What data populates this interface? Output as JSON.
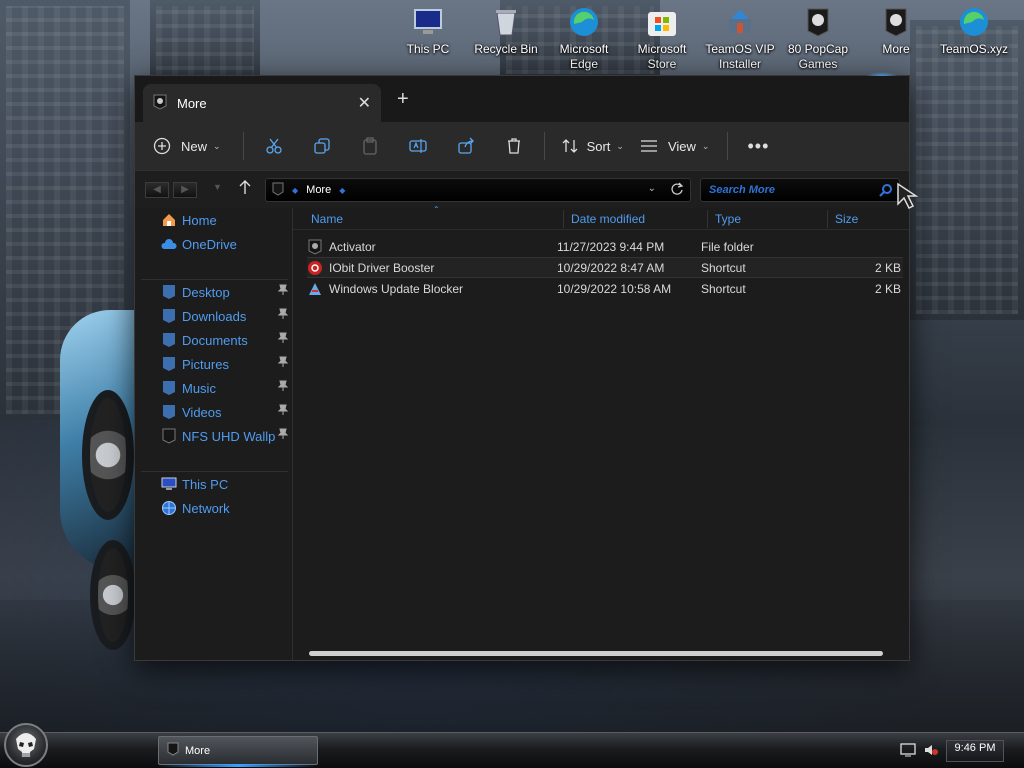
{
  "desktop": {
    "icons": [
      {
        "label": "This PC",
        "icon": "monitor-icon"
      },
      {
        "label": "Recycle Bin",
        "icon": "recycle-bin-icon"
      },
      {
        "label": "Microsoft Edge",
        "icon": "edge-icon"
      },
      {
        "label": "Microsoft Store",
        "icon": "store-icon"
      },
      {
        "label": "TeamOS VIP Installer",
        "icon": "installer-icon"
      },
      {
        "label": "80 PopCap Games",
        "icon": "folder-punisher-icon"
      },
      {
        "label": "More",
        "icon": "folder-punisher-icon"
      },
      {
        "label": "TeamOS.xyz",
        "icon": "edge-icon"
      }
    ]
  },
  "window": {
    "tab_title": "More",
    "toolbar": {
      "new_label": "New",
      "sort_label": "Sort",
      "view_label": "View"
    },
    "address": {
      "path": "More"
    },
    "search": {
      "placeholder": "Search More"
    },
    "sidebar": {
      "home": "Home",
      "onedrive": "OneDrive",
      "pinned": [
        "Desktop",
        "Downloads",
        "Documents",
        "Pictures",
        "Music",
        "Videos",
        "NFS UHD Wallp"
      ],
      "this_pc": "This PC",
      "network": "Network"
    },
    "columns": {
      "name": "Name",
      "date": "Date modified",
      "type": "Type",
      "size": "Size"
    },
    "files": [
      {
        "name": "Activator",
        "date": "11/27/2023 9:44 PM",
        "type": "File folder",
        "size": ""
      },
      {
        "name": "IObit Driver Booster",
        "date": "10/29/2022 8:47 AM",
        "type": "Shortcut",
        "size": "2 KB"
      },
      {
        "name": "Windows Update Blocker",
        "date": "10/29/2022 10:58 AM",
        "type": "Shortcut",
        "size": "2 KB"
      }
    ]
  },
  "taskbar": {
    "window_button": "More",
    "clock": "9:46 PM"
  },
  "colors": {
    "accent": "#4f9cf0",
    "window_bg": "#1c1c1c",
    "toolbar_bg": "#2a2a2a"
  }
}
